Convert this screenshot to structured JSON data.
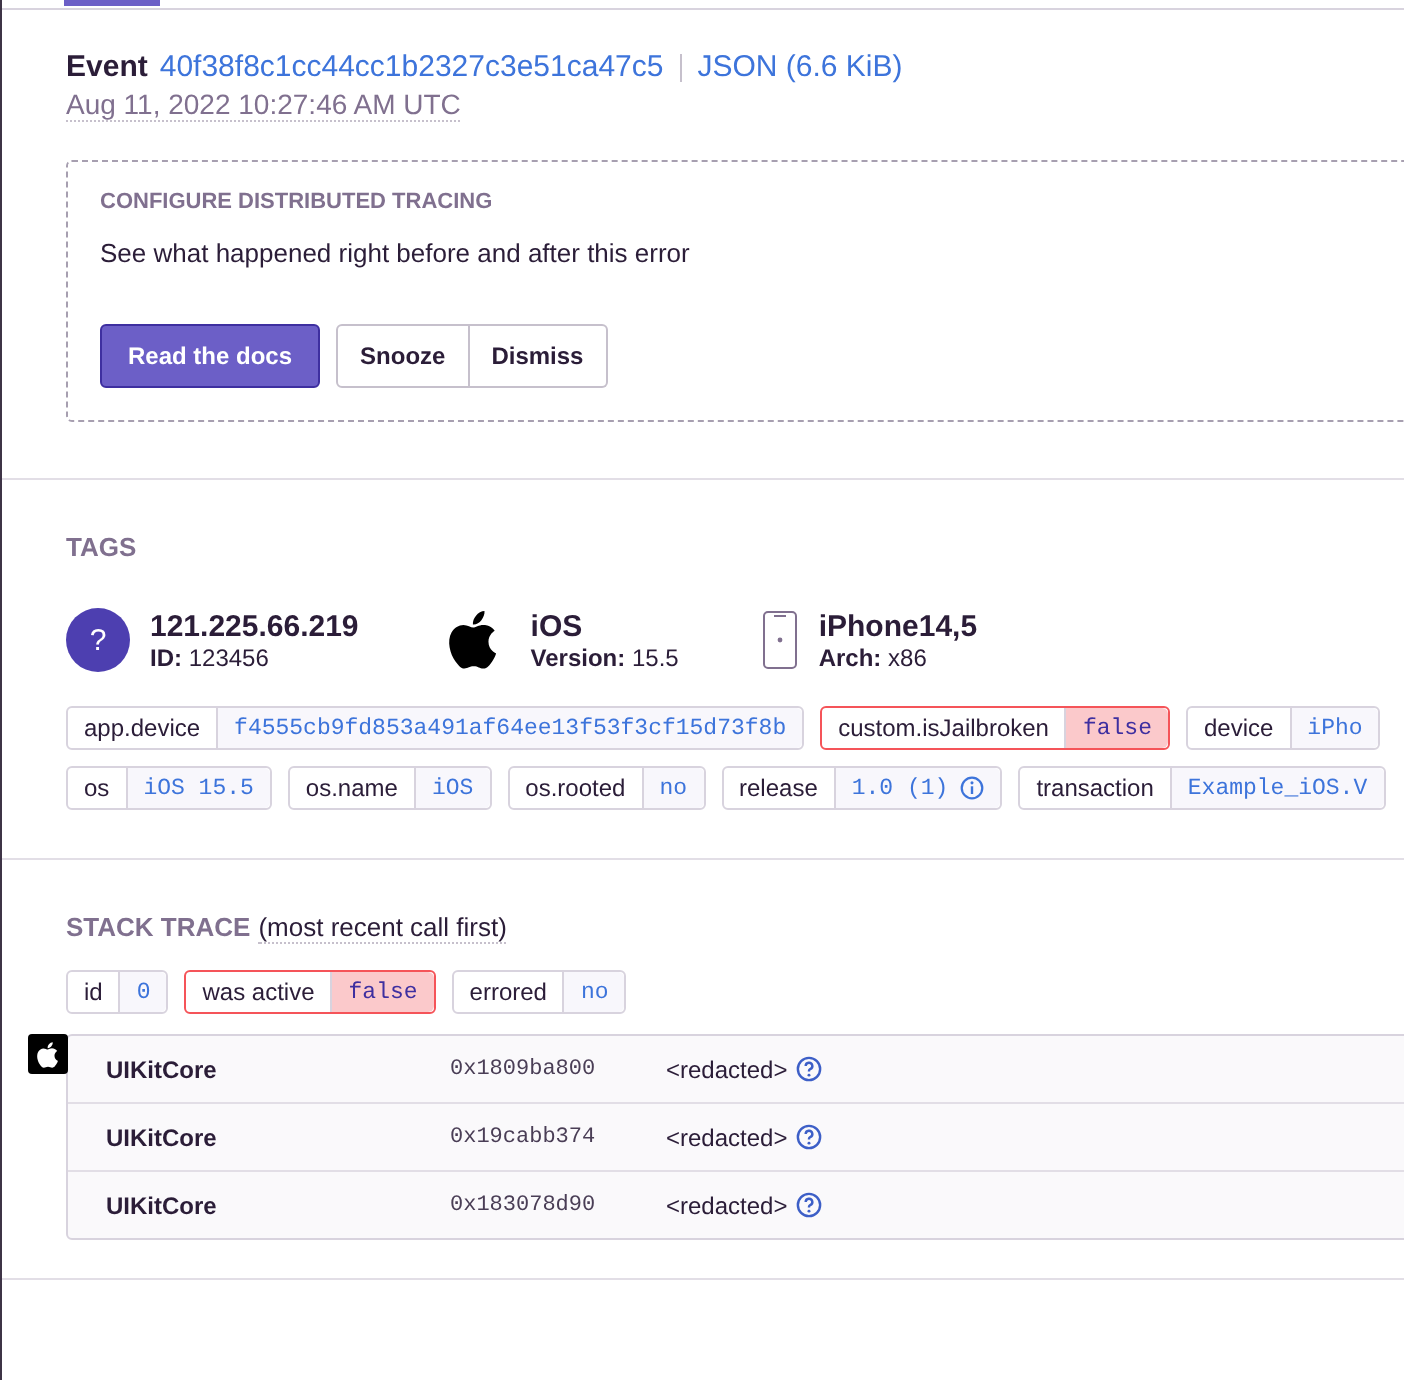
{
  "event": {
    "label": "Event",
    "id": "40f38f8c1cc44cc1b2327c3e51ca47c5",
    "json_link": "JSON (6.6 KiB)",
    "timestamp": "Aug 11, 2022 10:27:46 AM UTC"
  },
  "tracing_prompt": {
    "title": "CONFIGURE DISTRIBUTED TRACING",
    "text": "See what happened right before and after this error",
    "primary_button": "Read the docs",
    "buttons": [
      "Snooze",
      "Dismiss"
    ]
  },
  "tags": {
    "title": "TAGS",
    "summary": [
      {
        "kind": "user",
        "badge": "?",
        "title": "121.225.66.219",
        "key": "ID:",
        "value": "123456"
      },
      {
        "kind": "os",
        "title": "iOS",
        "key": "Version:",
        "value": "15.5"
      },
      {
        "kind": "device",
        "title": "iPhone14,5",
        "key": "Arch:",
        "value": "x86"
      }
    ],
    "tag_lines": [
      [
        {
          "key": "app.device",
          "value": "f4555cb9fd853a491af64ee13f53f3cf15d73f8b",
          "highlighted": false
        },
        {
          "key": "custom.isJailbroken",
          "value": "false",
          "highlighted": true
        },
        {
          "key": "device",
          "value": "iPho",
          "highlighted": false
        }
      ],
      [
        {
          "key": "os",
          "value": "iOS 15.5",
          "highlighted": false
        },
        {
          "key": "os.name",
          "value": "iOS",
          "highlighted": false
        },
        {
          "key": "os.rooted",
          "value": "no",
          "highlighted": false
        },
        {
          "key": "release",
          "value": "1.0 (1)",
          "highlighted": false,
          "info": true
        },
        {
          "key": "transaction",
          "value": "Example_iOS.V",
          "highlighted": false
        }
      ]
    ]
  },
  "stack_trace": {
    "title": "STACK TRACE",
    "subtitle": "(most recent call first)",
    "thread_tags": [
      {
        "key": "id",
        "value": "0",
        "highlighted": false
      },
      {
        "key": "was active",
        "value": "false",
        "highlighted": true
      },
      {
        "key": "errored",
        "value": "no",
        "highlighted": false
      }
    ],
    "frames": [
      {
        "module": "UIKitCore",
        "address": "0x1809ba800",
        "function": "<redacted>"
      },
      {
        "module": "UIKitCore",
        "address": "0x19cabb374",
        "function": "<redacted>"
      },
      {
        "module": "UIKitCore",
        "address": "0x183078d90",
        "function": "<redacted>"
      }
    ]
  }
}
